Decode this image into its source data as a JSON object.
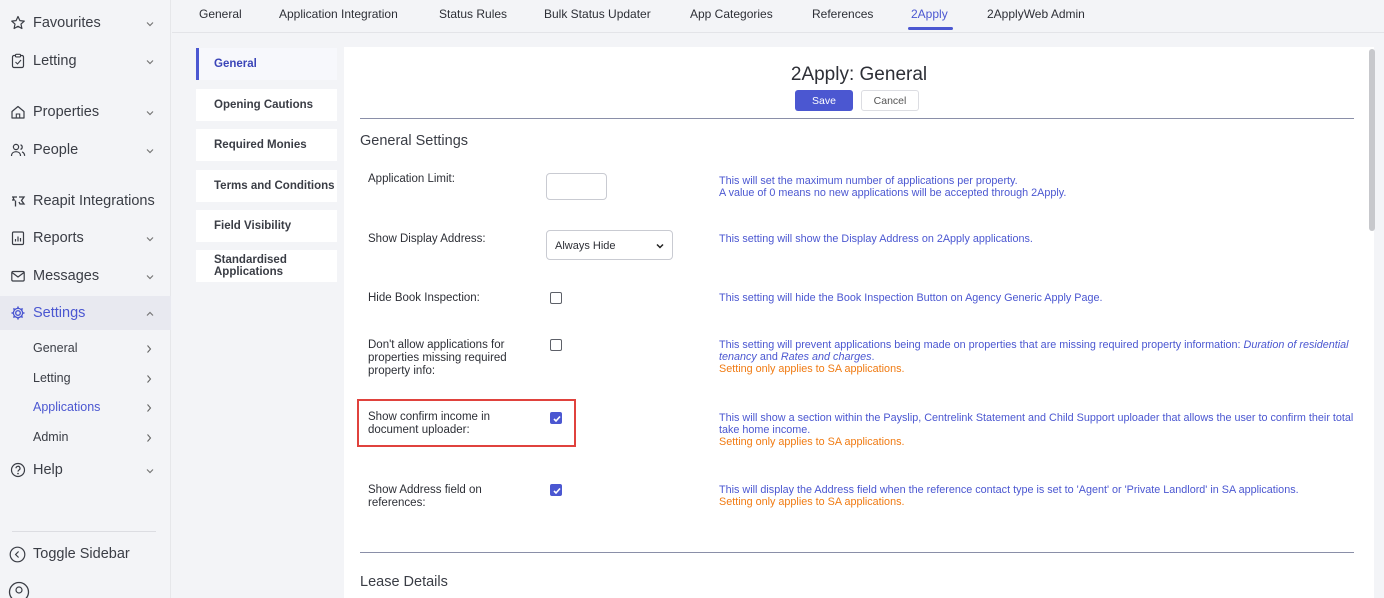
{
  "sidebar": {
    "items": [
      {
        "label": "Favourites",
        "icon": "star-icon"
      },
      {
        "label": "Letting",
        "icon": "clipboard-icon"
      },
      {
        "label": "Properties",
        "icon": "home-icon"
      },
      {
        "label": "People",
        "icon": "people-icon"
      },
      {
        "label": "Reapit Integrations",
        "icon": "integration-icon"
      },
      {
        "label": "Reports",
        "icon": "report-icon"
      },
      {
        "label": "Messages",
        "icon": "mail-icon"
      },
      {
        "label": "Settings",
        "icon": "gear-icon"
      },
      {
        "label": "Help",
        "icon": "help-icon"
      }
    ],
    "settings_sub": [
      {
        "label": "General"
      },
      {
        "label": "Letting"
      },
      {
        "label": "Applications"
      },
      {
        "label": "Admin"
      }
    ],
    "toggle_label": "Toggle Sidebar"
  },
  "tabs": [
    {
      "label": "General"
    },
    {
      "label": "Application Integration"
    },
    {
      "label": "Status Rules"
    },
    {
      "label": "Bulk Status Updater"
    },
    {
      "label": "App Categories"
    },
    {
      "label": "References"
    },
    {
      "label": "2Apply"
    },
    {
      "label": "2ApplyWeb Admin"
    }
  ],
  "submenu": [
    {
      "label": "General"
    },
    {
      "label": "Opening Cautions"
    },
    {
      "label": "Required Monies"
    },
    {
      "label": "Terms and Conditions"
    },
    {
      "label": "Field Visibility"
    },
    {
      "label": "Standardised Applications"
    }
  ],
  "main": {
    "title": "2Apply: General",
    "save_label": "Save",
    "cancel_label": "Cancel",
    "section_general": "General Settings",
    "section_lease": "Lease Details",
    "settings": [
      {
        "label": "Application Limit:",
        "value": "",
        "desc_1": "This will set the maximum number of applications per property.",
        "desc_2": "A value of 0 means no new applications will be accepted through 2Apply."
      },
      {
        "label": "Show Display Address:",
        "value": "Always Hide",
        "desc_1": "This setting will show the Display Address on 2Apply applications."
      },
      {
        "label": "Hide Book Inspection:",
        "checked": false,
        "desc_1": "This setting will hide the Book Inspection Button on Agency Generic Apply Page."
      },
      {
        "label": "Don't allow applications for properties missing required property info:",
        "checked": false,
        "desc_1": "This setting will prevent applications being made on properties that are missing required property information:",
        "desc_em1": "Duration of residential tenancy",
        "desc_and": "and",
        "desc_em2": "Rates and charges",
        "desc_end": ".",
        "note": "Setting only applies to SA applications."
      },
      {
        "label": "Show confirm income in document uploader:",
        "checked": true,
        "desc_1": "This will show a section within the Payslip, Centrelink Statement and Child Support uploader that allows the user to confirm their total take home income.",
        "note": "Setting only applies to SA applications."
      },
      {
        "label": "Show Address field on references:",
        "checked": true,
        "desc_1": "This will display the Address field when the reference contact type is set to 'Agent' or 'Private Landlord' in SA applications.",
        "note": "Setting only applies to SA applications."
      }
    ]
  },
  "colors": {
    "accent": "#4b57d1",
    "note": "#f07b13",
    "highlight": "#e0423d"
  }
}
